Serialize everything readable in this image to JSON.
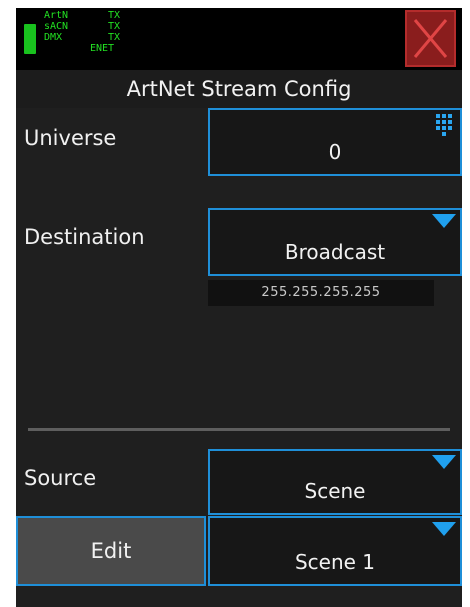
{
  "status": {
    "rows": [
      {
        "name": "ArtN",
        "state": "TX"
      },
      {
        "name": "sACN",
        "state": "TX"
      },
      {
        "name": "DMX",
        "state": "TX"
      }
    ],
    "network": "ENET"
  },
  "title": "ArtNet Stream Config",
  "universe": {
    "label": "Universe",
    "value": "0"
  },
  "destination": {
    "label": "Destination",
    "value": "Broadcast",
    "ip": "255.255.255.255"
  },
  "source": {
    "label": "Source",
    "value": "Scene"
  },
  "scene": {
    "edit_label": "Edit",
    "value": "Scene 1"
  },
  "colors": {
    "accent": "#1f8fd8",
    "status_green": "#22e022",
    "close_red": "#8a1d1d"
  }
}
